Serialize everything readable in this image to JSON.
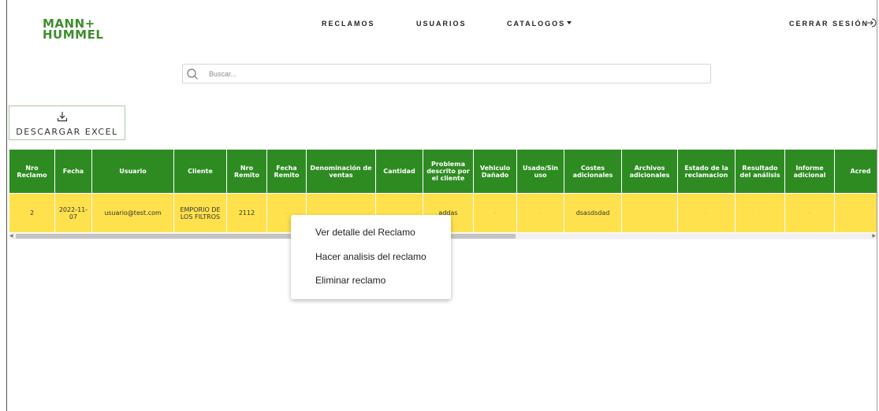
{
  "brand": {
    "line1": "MANN+",
    "line2": "HUMMEL",
    "color": "#3e8e2d"
  },
  "nav": {
    "reclamos": "RECLAMOS",
    "usuarios": "USUARIOS",
    "catalogos": "CATALOGOS",
    "logout": "CERRAR SESIÓN"
  },
  "search": {
    "placeholder": "Buscar..."
  },
  "excel_button": {
    "label": "DESCARGAR EXCEL"
  },
  "table": {
    "columns": [
      "Nro Reclamo",
      "Fecha",
      "Usuario",
      "Cliente",
      "Nro Remito",
      "Fecha Remito",
      "Denominación de ventas",
      "Cantidad",
      "Problema descrito por el cliente",
      "Vehiculo Dañado",
      "Usado/Sin uso",
      "Costes adicionales",
      "Archivos adicionales",
      "Estado de la reclamacion",
      "Resultado del análisis",
      "Informe adicional",
      "Acred"
    ],
    "rows": [
      [
        "2",
        "2022-11-07",
        "usuario@test.com",
        "EMPORIO DE LOS FILTROS",
        "2112",
        "-",
        "",
        "",
        "addas",
        "-",
        "-",
        "dsasdsdad",
        "",
        "-",
        "-",
        "-",
        ""
      ]
    ]
  },
  "context_menu": {
    "items": [
      "Ver detalle del Reclamo",
      "Hacer analisis del reclamo",
      "Eliminar reclamo"
    ]
  },
  "colors": {
    "header_green": "#2e8b22",
    "row_yellow": "#ffe14d"
  }
}
